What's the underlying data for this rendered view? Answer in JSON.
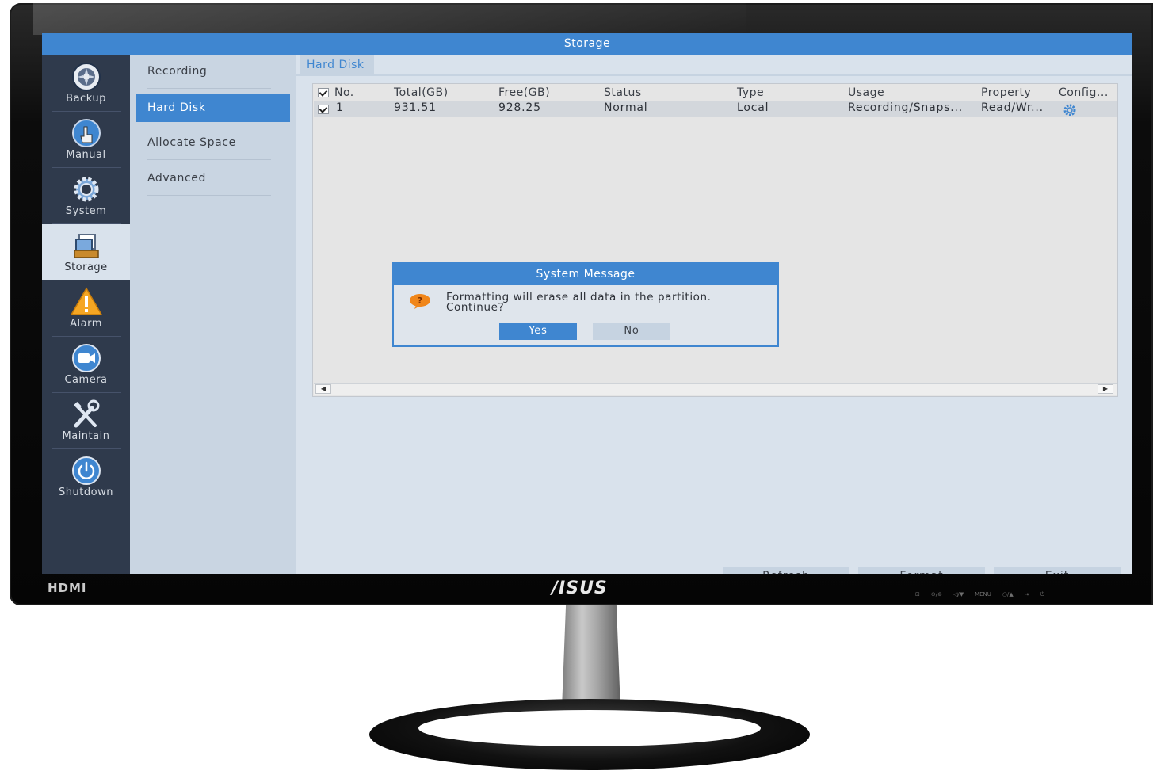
{
  "monitor": {
    "input_label": "HDMI",
    "brand": "/ISUS",
    "controls": [
      "⊡",
      "⊖/⊕",
      "◁/▼",
      "MENU",
      "○/▲",
      "⇥",
      "⏻"
    ]
  },
  "window": {
    "title": "Storage"
  },
  "left_nav": [
    {
      "label": "Backup",
      "icon": "backup-icon"
    },
    {
      "label": "Manual",
      "icon": "manual-icon"
    },
    {
      "label": "System",
      "icon": "gear-icon"
    },
    {
      "label": "Storage",
      "icon": "storage-icon",
      "active": true
    },
    {
      "label": "Alarm",
      "icon": "warning-icon"
    },
    {
      "label": "Camera",
      "icon": "camera-icon"
    },
    {
      "label": "Maintain",
      "icon": "tools-icon"
    },
    {
      "label": "Shutdown",
      "icon": "power-icon"
    }
  ],
  "sub_nav": [
    {
      "label": "Recording"
    },
    {
      "label": "Hard Disk",
      "active": true
    },
    {
      "label": "Allocate Space"
    },
    {
      "label": "Advanced"
    }
  ],
  "content": {
    "tab": "Hard Disk",
    "table": {
      "headers": [
        "No.",
        "Total(GB)",
        "Free(GB)",
        "Status",
        "Type",
        "Usage",
        "Property",
        "Config..."
      ],
      "rows": [
        {
          "no": "1",
          "total": "931.51",
          "free": "928.25",
          "status": "Normal",
          "type": "Local",
          "usage": "Recording/Snaps...",
          "property": "Read/Wr...",
          "config_icon": "gear-icon"
        }
      ]
    },
    "buttons": {
      "refresh": "Refresh",
      "format": "Format",
      "exit": "Exit"
    }
  },
  "dialog": {
    "title": "System Message",
    "icon": "question-icon",
    "message": "Formatting will erase all data in the partition. Continue?",
    "yes": "Yes",
    "no": "No"
  },
  "colors": {
    "accent": "#3f86d0",
    "nav_bg": "#2f3a4c",
    "subnav_bg": "#c9d5e2",
    "content_bg": "#d9e2ec"
  }
}
